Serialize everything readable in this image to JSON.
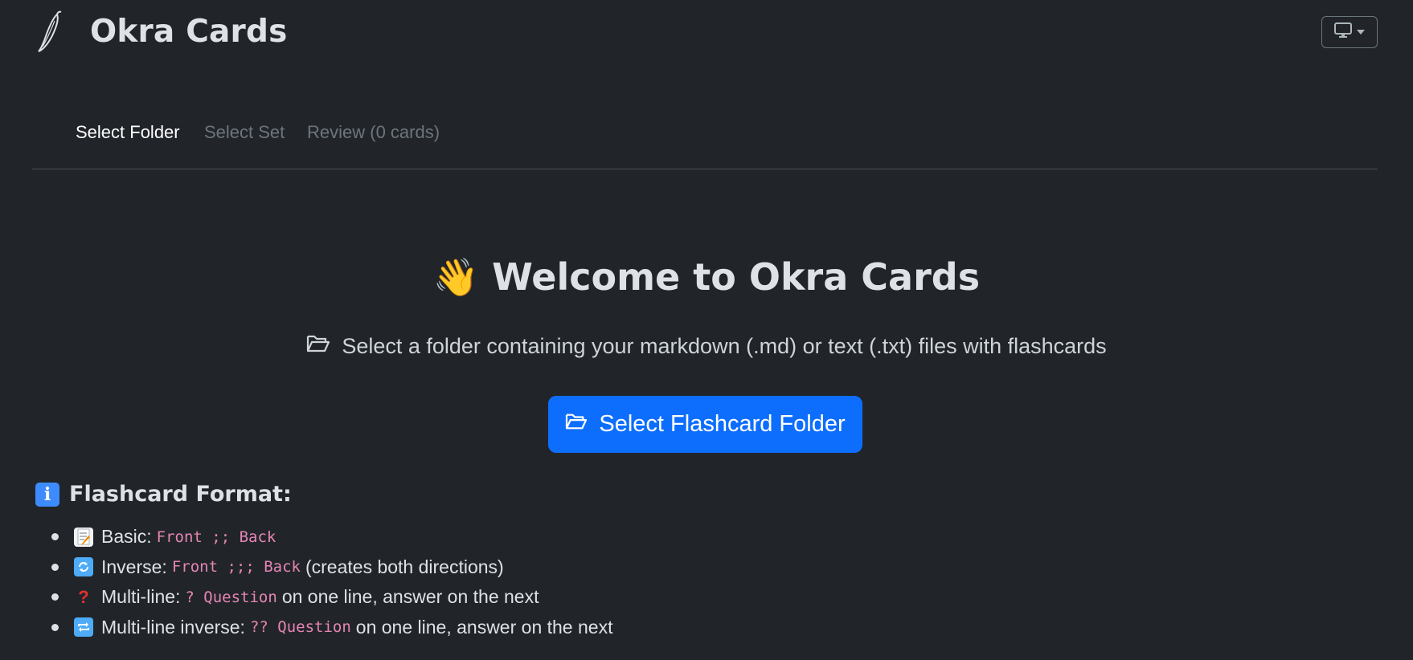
{
  "header": {
    "title": "Okra Cards",
    "theme_button_icon": "monitor-icon"
  },
  "tabs": [
    {
      "label": "Select Folder",
      "state": "active"
    },
    {
      "label": "Select Set",
      "state": "disabled"
    },
    {
      "label": "Review (0 cards)",
      "state": "disabled"
    }
  ],
  "welcome": {
    "emoji": "👋",
    "heading": "Welcome to Okra Cards",
    "subtitle": "Select a folder containing your markdown (.md) or text (.txt) files with flashcards",
    "button_label": "Select Flashcard Folder"
  },
  "format": {
    "title": "Flashcard Format:",
    "items": [
      {
        "icon": "memo-icon",
        "label": "Basic:",
        "code": "Front ;; Back",
        "suffix": ""
      },
      {
        "icon": "arrows-cycle-icon",
        "label": "Inverse:",
        "code": "Front ;;; Back",
        "suffix": "(creates both directions)"
      },
      {
        "icon": "question-mark-icon",
        "label": "Multi-line:",
        "code": "? Question",
        "suffix": "on one line, answer on the next"
      },
      {
        "icon": "repeat-icon",
        "label": "Multi-line inverse:",
        "code": "?? Question",
        "suffix": "on one line, answer on the next"
      }
    ]
  },
  "colors": {
    "background": "#212529",
    "primary": "#0d6efd",
    "code": "#e685b5"
  }
}
